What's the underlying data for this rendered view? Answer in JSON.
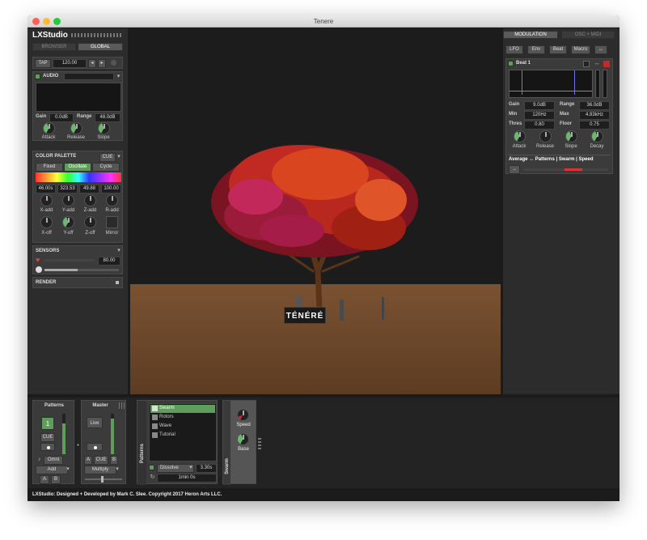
{
  "window": {
    "title": "Tenere"
  },
  "left": {
    "logo": "LXStudio",
    "tabs": [
      "BROWSER",
      "GLOBAL"
    ],
    "tempo": {
      "tap": "TAP",
      "bpm": "120.00",
      "prev": "◂",
      "next": "▸"
    },
    "audio": {
      "title": "AUDIO",
      "device": "",
      "gain_label": "Gain",
      "gain": "0.0dB",
      "range_label": "Range",
      "range": "48.0dB",
      "knobs": [
        "Attack",
        "Release",
        "Slope"
      ]
    },
    "palette": {
      "title": "COLOR PALETTE",
      "mode": "CUE",
      "buttons": [
        "Fixed",
        "Oscillate",
        "Cycle"
      ],
      "values": [
        "46.00s",
        "323.53",
        "49.88",
        "100.00"
      ],
      "knobs1": [
        "X-add",
        "Y-add",
        "Z-add",
        "R-add"
      ],
      "knobs2": [
        "X-off",
        "Y-off",
        "Z-off",
        "Mirror"
      ]
    },
    "sensors": {
      "title": "SENSORS",
      "value": "80.00"
    },
    "render": {
      "title": "RENDER"
    }
  },
  "viewport": {
    "sign": "TÉNÉRÉ"
  },
  "right": {
    "tabs": [
      "MODULATION",
      "OSC + MIDI"
    ],
    "mod_buttons": [
      "LFO",
      "Env",
      "Beat",
      "Macro",
      "↔"
    ],
    "beat": {
      "title": "Beat 1",
      "rows": [
        {
          "l1": "Gain",
          "v1": "9.0dB",
          "l2": "Range",
          "v2": "36.0dB"
        },
        {
          "l1": "Min",
          "v1": "120Hz",
          "l2": "Max",
          "v2": "4.83kHz"
        },
        {
          "l1": "Thres",
          "v1": "0.80",
          "l2": "Floor",
          "v2": "0.75"
        }
      ],
      "knobs": [
        "Attack",
        "Release",
        "Slope",
        "Decay"
      ],
      "mapping": "Average ↔ Patterns | Swarm | Speed",
      "arrow": "→"
    }
  },
  "bottom": {
    "patterns_header": "Patterns",
    "master_header": "Master",
    "channel_value": "1",
    "live": "Live",
    "cue": "CUE",
    "omni": "Omni",
    "blend_left": "Add",
    "blend_right": "Multiply",
    "a": "A",
    "b": "B",
    "cue2": "CUE",
    "channel_side": "Patterns",
    "patterns": [
      "Swarm",
      "Rotors",
      "Wave",
      "Tutorial"
    ],
    "transition": "Dissolve",
    "transition_time": "3.30s",
    "auto_cycle": "1min 0s",
    "device_side": "Swarm",
    "device_knobs": [
      "Speed",
      "Base"
    ]
  },
  "footer": "LXStudio: Designed + Developed by Mark C. Slee. Copyright 2017 Heron Arts LLC.",
  "colors": {
    "accent": "#5f9e5a",
    "sign_bg": "#1a1a1a",
    "ground": "#7a5232",
    "sensor_heart": "#e0443a"
  }
}
